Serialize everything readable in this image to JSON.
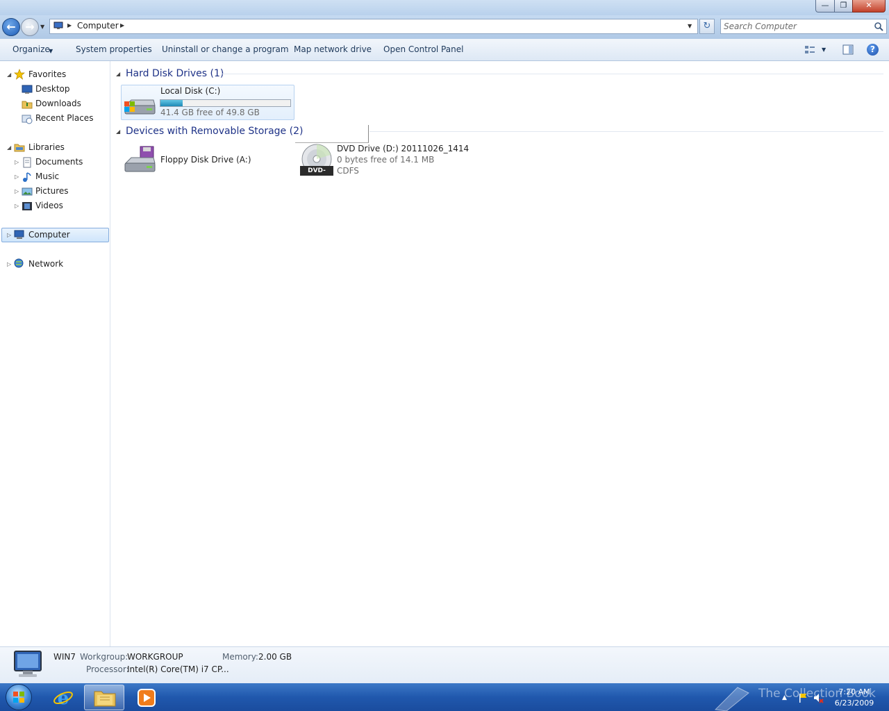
{
  "window": {
    "minimize_label": "—",
    "maximize_label": "❐",
    "close_label": "✕"
  },
  "address_bar": {
    "location": "Computer",
    "search_placeholder": "Search Computer"
  },
  "command_bar": {
    "organize": "Organize",
    "system_properties": "System properties",
    "uninstall": "Uninstall or change a program",
    "map_drive": "Map network drive",
    "control_panel": "Open Control Panel",
    "help_label": "?"
  },
  "nav_pane": {
    "favorites": {
      "label": "Favorites",
      "items": [
        "Desktop",
        "Downloads",
        "Recent Places"
      ]
    },
    "libraries": {
      "label": "Libraries",
      "items": [
        "Documents",
        "Music",
        "Pictures",
        "Videos"
      ]
    },
    "computer": "Computer",
    "network": "Network"
  },
  "content": {
    "hard_disk_group": "Hard Disk Drives (1)",
    "removable_group": "Devices with Removable Storage (2)",
    "drives": [
      {
        "name": "Local Disk (C:)",
        "detail": "41.4 GB free of 49.8 GB",
        "used_fraction": 0.169
      },
      {
        "name": "Floppy Disk Drive (A:)"
      },
      {
        "name": "DVD Drive (D:) 20111026_1414",
        "detail": "0 bytes free of 14.1 MB",
        "filesystem": "CDFS",
        "icon_badge": "DVD-ROM"
      }
    ]
  },
  "details": {
    "computer_name": "WIN7",
    "workgroup_label": "Workgroup:",
    "workgroup_value": "WORKGROUP",
    "memory_label": "Memory:",
    "memory_value": "2.00 GB",
    "processor_label": "Processor:",
    "processor_value": "Intel(R) Core(TM) i7 CP..."
  },
  "taskbar": {
    "watermark": "The Collection Book",
    "time": "7:20 AM",
    "date": "6/23/2009"
  }
}
